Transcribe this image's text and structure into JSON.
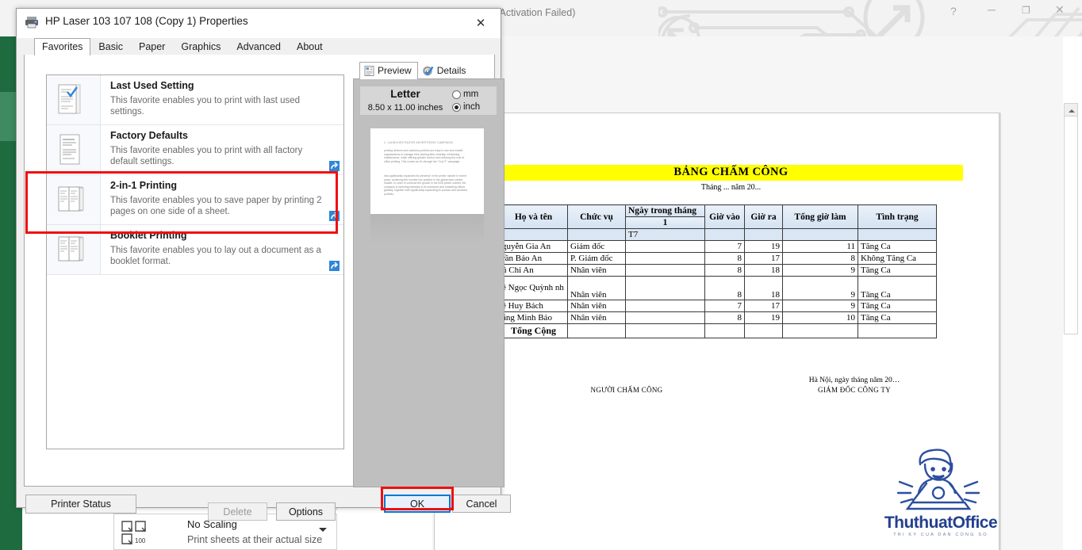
{
  "excel": {
    "title": "cel (Product Activation Failed)",
    "window_controls": {
      "help": "?",
      "minimize": "─",
      "maximize": "❐",
      "close": "✕"
    },
    "scaling": {
      "label": "No Scaling",
      "description": "Print sheets at their actual size",
      "icon_number": "100"
    }
  },
  "sheet": {
    "title": "BẢNG CHẤM CÔNG",
    "subtitle": "Tháng ... năm 20...",
    "headers": [
      "Họ và tên",
      "Chức vụ",
      "Ngày trong tháng",
      "Giờ vào",
      "Giờ ra",
      "Tổng giờ làm",
      "Tình trạng"
    ],
    "day_number": "1",
    "weekday_cell": "T7",
    "rows": [
      {
        "name": "guyễn Gia An",
        "role": "Giám đốc",
        "day": "",
        "in": "7",
        "out": "19",
        "total": "11",
        "status": "Tăng Ca"
      },
      {
        "name": "rần Bảo An",
        "role": "P. Giám đốc",
        "day": "",
        "in": "8",
        "out": "17",
        "total": "8",
        "status": "Không Tăng Ca"
      },
      {
        "name": "ũ Chi An",
        "role": "Nhân viên",
        "day": "",
        "in": "8",
        "out": "18",
        "total": "9",
        "status": "Tăng Ca"
      },
      {
        "name": "ê Ngọc Quỳnh nh",
        "role": "Nhân viên",
        "day": "",
        "in": "8",
        "out": "18",
        "total": "9",
        "status": "Tăng Ca"
      },
      {
        "name": "ê Huy Bách",
        "role": "Nhân viên",
        "day": "",
        "in": "7",
        "out": "17",
        "total": "9",
        "status": "Tăng Ca"
      },
      {
        "name": "ăng Minh Bảo",
        "role": "Nhân viên",
        "day": "",
        "in": "8",
        "out": "19",
        "total": "10",
        "status": "Tăng Ca"
      }
    ],
    "total_label": "Tổng Cộng",
    "sign_left": "NGƯỜI CHẤM CÔNG",
    "sign_right_date": "Hà Nội, ngày        tháng        năm 20…",
    "sign_right_title": "GIÁM ĐỐC CÔNG TY"
  },
  "watermark": {
    "brand": "ThuthuatOffice",
    "tagline": "TRI KY CUA DAN CONG SO"
  },
  "dialog": {
    "title": "HP Laser 103 107 108 (Copy 1) Properties",
    "close_glyph": "✕",
    "tabs": [
      "Favorites",
      "Basic",
      "Paper",
      "Graphics",
      "Advanced",
      "About"
    ],
    "selected_tab": "Favorites",
    "favorites": [
      {
        "name": "Last Used Setting",
        "desc": "This favorite enables you to print with last used settings.",
        "badge": false,
        "thumb": "single-page-check"
      },
      {
        "name": "Factory Defaults",
        "desc": "This favorite enables you to print with all factory default settings.",
        "badge": true,
        "thumb": "single-page"
      },
      {
        "name": "2-in-1 Printing",
        "desc": "This favorite enables you to save paper by printing 2 pages on one side of a sheet.",
        "badge": true,
        "thumb": "two-page"
      },
      {
        "name": "Booklet Printing",
        "desc": "This favorite enables you to lay out a document as a booklet format.",
        "badge": true,
        "thumb": "two-page"
      }
    ],
    "selected_favorite": "2-in-1 Printing",
    "buttons": {
      "delete": "Delete",
      "options": "Options",
      "printer_status": "Printer Status",
      "ok": "OK",
      "cancel": "Cancel"
    },
    "preview": {
      "tabs": [
        "Preview",
        "Details"
      ],
      "selected_tab": "Preview",
      "paper_size": "Letter",
      "paper_dimensions": "8.50 x 11.00 inches",
      "unit_mm": "mm",
      "unit_inch": "inch",
      "selected_unit": "inch",
      "page_heading": "1. LAUNCHES RAZOR ADVERTISING CAMPAIGN",
      "page_para1": "printing devices and solutions portfolio are easy to use and enable organisations to manage their printing fleet centrally, minimising maintenance, while offering greater control and reducing the cost of office printing. This comes as it's through the \"Cut-IT\" campaign.",
      "page_para2": "has significantly expanded its presence in the printer market in recent years, achieving the number two position in the global laser printer market. In order to continue the growth in the B2B printer market, the company is investing intensely in its workforce and marketing efforts globally, together with significantly expanding its product and solutions portfolio."
    }
  },
  "colors": {
    "highlight_red": "#ef0f10",
    "excel_green": "#1e6b40",
    "header_blue": "#dbe6f4",
    "title_yellow": "#ffff00",
    "accent_blue": "#0078d7",
    "brand_blue": "#23408e"
  }
}
